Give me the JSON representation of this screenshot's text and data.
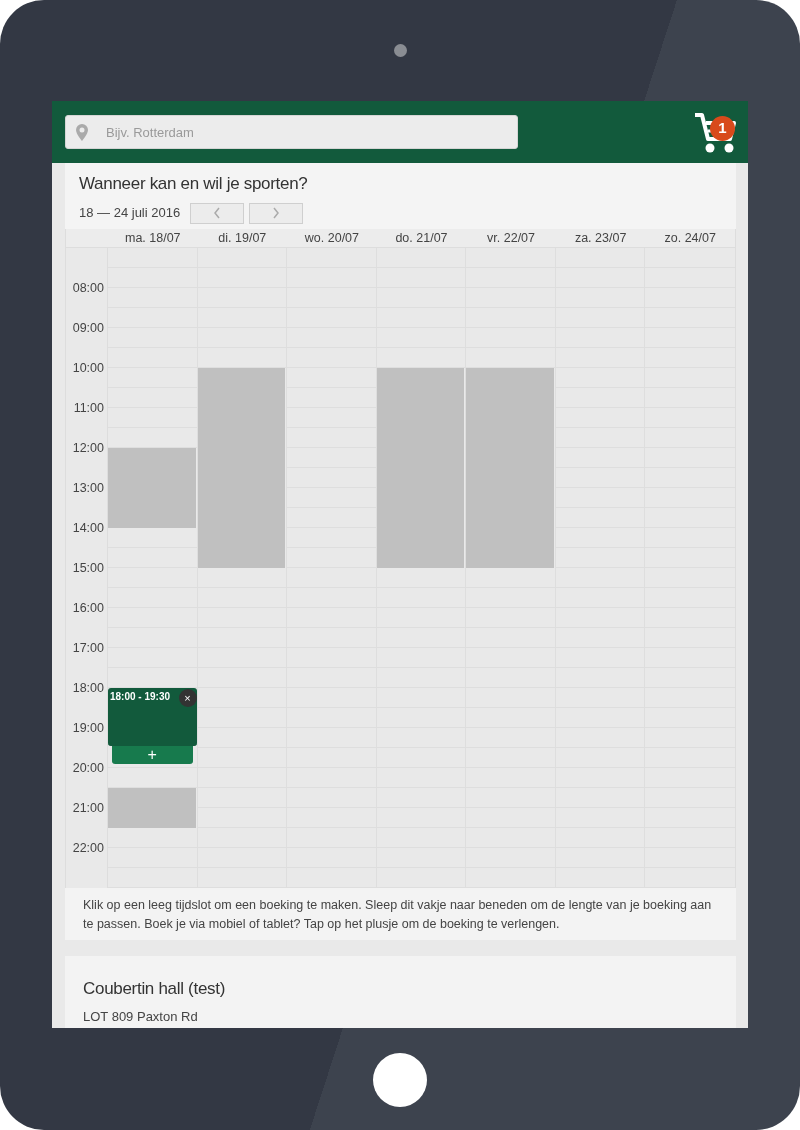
{
  "header": {
    "search": {
      "placeholder": "Bijv. Rotterdam"
    },
    "cart": {
      "count": "1"
    }
  },
  "planner": {
    "title": "Wanneer kan en wil je sporten?",
    "date_range": "18 — 24 juli 2016",
    "days": [
      {
        "label": "ma. 18/07",
        "booking": {
          "label": "18:00 - 19:30",
          "close": "×",
          "plus": "+"
        },
        "slots": [
          {
            "kind": "free"
          },
          {
            "kind": "free"
          },
          {
            "kind": "free"
          },
          {
            "kind": "free"
          },
          {
            "kind": "free"
          },
          {
            "kind": "free"
          },
          {
            "kind": "free"
          },
          {
            "kind": "free"
          },
          {
            "kind": "free"
          },
          {
            "kind": "free"
          },
          {
            "kind": "blocked"
          },
          {
            "kind": "blocked"
          },
          {
            "kind": "blocked"
          },
          {
            "kind": "blocked"
          },
          {
            "kind": "free"
          },
          {
            "kind": "free"
          },
          {
            "kind": "free"
          },
          {
            "kind": "free"
          },
          {
            "kind": "free"
          },
          {
            "kind": "free"
          },
          {
            "kind": "free"
          },
          {
            "kind": "free"
          },
          {
            "kind": "booked"
          },
          {
            "kind": "booked"
          },
          {
            "kind": "booked"
          },
          {
            "kind": "free"
          },
          {
            "kind": "free"
          },
          {
            "kind": "blocked"
          },
          {
            "kind": "blocked"
          },
          {
            "kind": "free"
          },
          {
            "kind": "free"
          },
          {
            "kind": "free"
          }
        ]
      },
      {
        "label": "di. 19/07",
        "slots": [
          {
            "kind": "free"
          },
          {
            "kind": "free"
          },
          {
            "kind": "free"
          },
          {
            "kind": "free"
          },
          {
            "kind": "free"
          },
          {
            "kind": "free"
          },
          {
            "kind": "blocked"
          },
          {
            "kind": "blocked"
          },
          {
            "kind": "blocked"
          },
          {
            "kind": "blocked"
          },
          {
            "kind": "blocked"
          },
          {
            "kind": "blocked"
          },
          {
            "kind": "blocked"
          },
          {
            "kind": "blocked"
          },
          {
            "kind": "blocked"
          },
          {
            "kind": "blocked"
          },
          {
            "kind": "free"
          },
          {
            "kind": "free"
          },
          {
            "kind": "free"
          },
          {
            "kind": "free"
          },
          {
            "kind": "free"
          },
          {
            "kind": "free"
          },
          {
            "kind": "free"
          },
          {
            "kind": "free"
          },
          {
            "kind": "free"
          },
          {
            "kind": "free"
          },
          {
            "kind": "free"
          },
          {
            "kind": "free"
          },
          {
            "kind": "free"
          },
          {
            "kind": "free"
          },
          {
            "kind": "free"
          },
          {
            "kind": "free"
          }
        ]
      },
      {
        "label": "wo. 20/07",
        "slots": [
          {
            "kind": "free"
          },
          {
            "kind": "free"
          },
          {
            "kind": "free"
          },
          {
            "kind": "free"
          },
          {
            "kind": "free"
          },
          {
            "kind": "free"
          },
          {
            "kind": "free"
          },
          {
            "kind": "free"
          },
          {
            "kind": "free"
          },
          {
            "kind": "free"
          },
          {
            "kind": "free"
          },
          {
            "kind": "free"
          },
          {
            "kind": "free"
          },
          {
            "kind": "free"
          },
          {
            "kind": "free"
          },
          {
            "kind": "free"
          },
          {
            "kind": "free"
          },
          {
            "kind": "free"
          },
          {
            "kind": "free"
          },
          {
            "kind": "free"
          },
          {
            "kind": "free"
          },
          {
            "kind": "free"
          },
          {
            "kind": "free"
          },
          {
            "kind": "free"
          },
          {
            "kind": "free"
          },
          {
            "kind": "free"
          },
          {
            "kind": "free"
          },
          {
            "kind": "free"
          },
          {
            "kind": "free"
          },
          {
            "kind": "free"
          },
          {
            "kind": "free"
          },
          {
            "kind": "free"
          }
        ]
      },
      {
        "label": "do. 21/07",
        "slots": [
          {
            "kind": "free"
          },
          {
            "kind": "free"
          },
          {
            "kind": "free"
          },
          {
            "kind": "free"
          },
          {
            "kind": "free"
          },
          {
            "kind": "free"
          },
          {
            "kind": "blocked"
          },
          {
            "kind": "blocked"
          },
          {
            "kind": "blocked"
          },
          {
            "kind": "blocked"
          },
          {
            "kind": "blocked"
          },
          {
            "kind": "blocked"
          },
          {
            "kind": "blocked"
          },
          {
            "kind": "blocked"
          },
          {
            "kind": "blocked"
          },
          {
            "kind": "blocked"
          },
          {
            "kind": "free"
          },
          {
            "kind": "free"
          },
          {
            "kind": "free"
          },
          {
            "kind": "free"
          },
          {
            "kind": "free"
          },
          {
            "kind": "free"
          },
          {
            "kind": "free"
          },
          {
            "kind": "free"
          },
          {
            "kind": "free"
          },
          {
            "kind": "free"
          },
          {
            "kind": "free"
          },
          {
            "kind": "free"
          },
          {
            "kind": "free"
          },
          {
            "kind": "free"
          },
          {
            "kind": "free"
          },
          {
            "kind": "free"
          }
        ]
      },
      {
        "label": "vr. 22/07",
        "slots": [
          {
            "kind": "free"
          },
          {
            "kind": "free"
          },
          {
            "kind": "free"
          },
          {
            "kind": "free"
          },
          {
            "kind": "free"
          },
          {
            "kind": "free"
          },
          {
            "kind": "blocked"
          },
          {
            "kind": "blocked"
          },
          {
            "kind": "blocked"
          },
          {
            "kind": "blocked"
          },
          {
            "kind": "blocked"
          },
          {
            "kind": "blocked"
          },
          {
            "kind": "blocked"
          },
          {
            "kind": "blocked"
          },
          {
            "kind": "blocked"
          },
          {
            "kind": "blocked"
          },
          {
            "kind": "free"
          },
          {
            "kind": "free"
          },
          {
            "kind": "free"
          },
          {
            "kind": "free"
          },
          {
            "kind": "free"
          },
          {
            "kind": "free"
          },
          {
            "kind": "free"
          },
          {
            "kind": "free"
          },
          {
            "kind": "free"
          },
          {
            "kind": "free"
          },
          {
            "kind": "free"
          },
          {
            "kind": "free"
          },
          {
            "kind": "free"
          },
          {
            "kind": "free"
          },
          {
            "kind": "free"
          },
          {
            "kind": "free"
          }
        ]
      },
      {
        "label": "za. 23/07",
        "slots": [
          {
            "kind": "free"
          },
          {
            "kind": "free"
          },
          {
            "kind": "free"
          },
          {
            "kind": "free"
          },
          {
            "kind": "free"
          },
          {
            "kind": "free"
          },
          {
            "kind": "free"
          },
          {
            "kind": "free"
          },
          {
            "kind": "free"
          },
          {
            "kind": "free"
          },
          {
            "kind": "free"
          },
          {
            "kind": "free"
          },
          {
            "kind": "free"
          },
          {
            "kind": "free"
          },
          {
            "kind": "free"
          },
          {
            "kind": "free"
          },
          {
            "kind": "free"
          },
          {
            "kind": "free"
          },
          {
            "kind": "free"
          },
          {
            "kind": "free"
          },
          {
            "kind": "free"
          },
          {
            "kind": "free"
          },
          {
            "kind": "free"
          },
          {
            "kind": "free"
          },
          {
            "kind": "free"
          },
          {
            "kind": "free"
          },
          {
            "kind": "free"
          },
          {
            "kind": "free"
          },
          {
            "kind": "free"
          },
          {
            "kind": "free"
          },
          {
            "kind": "free"
          },
          {
            "kind": "free"
          }
        ]
      },
      {
        "label": "zo. 24/07",
        "slots": [
          {
            "kind": "free"
          },
          {
            "kind": "free"
          },
          {
            "kind": "free"
          },
          {
            "kind": "free"
          },
          {
            "kind": "free"
          },
          {
            "kind": "free"
          },
          {
            "kind": "free"
          },
          {
            "kind": "free"
          },
          {
            "kind": "free"
          },
          {
            "kind": "free"
          },
          {
            "kind": "free"
          },
          {
            "kind": "free"
          },
          {
            "kind": "free"
          },
          {
            "kind": "free"
          },
          {
            "kind": "free"
          },
          {
            "kind": "free"
          },
          {
            "kind": "free"
          },
          {
            "kind": "free"
          },
          {
            "kind": "free"
          },
          {
            "kind": "free"
          },
          {
            "kind": "free"
          },
          {
            "kind": "free"
          },
          {
            "kind": "free"
          },
          {
            "kind": "free"
          },
          {
            "kind": "free"
          },
          {
            "kind": "free"
          },
          {
            "kind": "free"
          },
          {
            "kind": "free"
          },
          {
            "kind": "free"
          },
          {
            "kind": "free"
          },
          {
            "kind": "free"
          },
          {
            "kind": "free"
          }
        ]
      }
    ],
    "hours": [
      "08:00",
      "09:00",
      "10:00",
      "11:00",
      "12:00",
      "13:00",
      "14:00",
      "15:00",
      "16:00",
      "17:00",
      "18:00",
      "19:00",
      "20:00",
      "21:00",
      "22:00"
    ],
    "hint": "Klik op een leeg tijdslot om een boeking te maken. Sleep dit vakje naar beneden om de lengte van je boeking aan te passen. Boek je via mobiel of tablet? Tap op het plusje om de boeking te verlengen."
  },
  "venue": {
    "name": "Coubertin hall (test)",
    "address": "LOT 809 Paxton Rd"
  }
}
